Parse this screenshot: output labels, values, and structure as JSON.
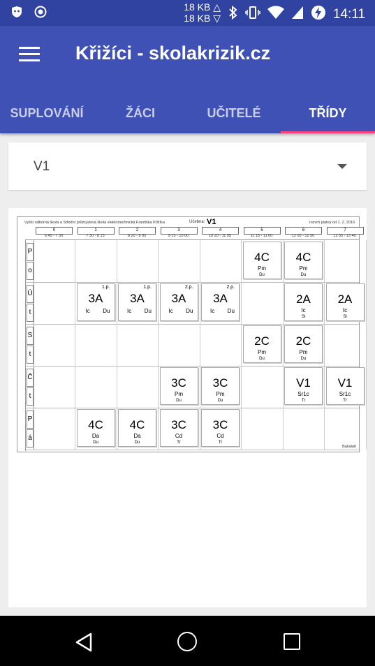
{
  "status_bar": {
    "net_up": "18 KB",
    "net_down": "18 KB",
    "time": "14:11",
    "icons": [
      "shield-icon",
      "circle-record-icon",
      "bluetooth-icon",
      "vibrate-icon",
      "wifi-icon",
      "signal-icon",
      "battery-charging-icon"
    ]
  },
  "app_bar": {
    "title": "Křižíci - skolakrizik.cz",
    "tabs": [
      {
        "label": "SUPLOVÁNÍ",
        "active": false
      },
      {
        "label": "ŽÁCI",
        "active": false
      },
      {
        "label": "UČITELÉ",
        "active": false
      },
      {
        "label": "TŘÍDY",
        "active": true
      }
    ],
    "accent": "#3f51b5",
    "indicator": "#ff4081"
  },
  "selector": {
    "value": "V1"
  },
  "timetable": {
    "school": "Vyšší odborná škola a Střední průmyslová škola elektrotechnická Františka Křižíka",
    "room_label": "Učebna:",
    "room": "V1",
    "valid_from": "rozvrh platný od 1. 2. 2016",
    "periods": [
      {
        "num": "0",
        "time": "6 45 - 7 30"
      },
      {
        "num": "1",
        "time": "7 30 - 8 15"
      },
      {
        "num": "2",
        "time": "8 20 - 9 05"
      },
      {
        "num": "3",
        "time": "9 15 - 10 00"
      },
      {
        "num": "4",
        "time": "10 20 - 11 05"
      },
      {
        "num": "5",
        "time": "11 15 - 11 00"
      },
      {
        "num": "6",
        "time": "12 05 - 12 50"
      },
      {
        "num": "7",
        "time": "12 55 - 13 40"
      }
    ],
    "days": [
      {
        "l1": "P",
        "l2": "o"
      },
      {
        "l1": "Ú",
        "l2": "t"
      },
      {
        "l1": "S",
        "l2": "t"
      },
      {
        "l1": "Č",
        "l2": "t"
      },
      {
        "l1": "P",
        "l2": "á"
      }
    ],
    "lessons": [
      {
        "day": 0,
        "period": 5,
        "cls": "4C",
        "subject": "Pm",
        "teacher": "Du"
      },
      {
        "day": 0,
        "period": 6,
        "cls": "4C",
        "subject": "Pm",
        "teacher": "Du"
      },
      {
        "day": 1,
        "period": 1,
        "cls": "3A",
        "group": "1.p.",
        "subject": "Ic",
        "teacher": "Du",
        "split": true
      },
      {
        "day": 1,
        "period": 2,
        "cls": "3A",
        "group": "1.p.",
        "subject": "Ic",
        "teacher": "Du",
        "split": true
      },
      {
        "day": 1,
        "period": 3,
        "cls": "3A",
        "group": "2.p.",
        "subject": "Ic",
        "teacher": "Du",
        "split": true
      },
      {
        "day": 1,
        "period": 4,
        "cls": "3A",
        "group": "2.p.",
        "subject": "Ic",
        "teacher": "Du",
        "split": true
      },
      {
        "day": 1,
        "period": 6,
        "cls": "2A",
        "subject": "Ic",
        "teacher": "Sl"
      },
      {
        "day": 1,
        "period": 7,
        "cls": "2A",
        "subject": "Ic",
        "teacher": "Sl"
      },
      {
        "day": 2,
        "period": 5,
        "cls": "2C",
        "subject": "Pm",
        "teacher": "Du"
      },
      {
        "day": 2,
        "period": 6,
        "cls": "2C",
        "subject": "Pm",
        "teacher": "Du"
      },
      {
        "day": 3,
        "period": 3,
        "cls": "3C",
        "subject": "Pm",
        "teacher": "Du"
      },
      {
        "day": 3,
        "period": 4,
        "cls": "3C",
        "subject": "Pm",
        "teacher": "Du"
      },
      {
        "day": 3,
        "period": 6,
        "cls": "V1",
        "subject": "Sr1c",
        "teacher": "Tr"
      },
      {
        "day": 3,
        "period": 7,
        "cls": "V1",
        "subject": "Sr1c",
        "teacher": "Tr"
      },
      {
        "day": 4,
        "period": 1,
        "cls": "4C",
        "subject": "Da",
        "teacher": "Du"
      },
      {
        "day": 4,
        "period": 2,
        "cls": "4C",
        "subject": "Da",
        "teacher": "Du"
      },
      {
        "day": 4,
        "period": 3,
        "cls": "3C",
        "subject": "Cd",
        "teacher": "Tr"
      },
      {
        "day": 4,
        "period": 4,
        "cls": "3C",
        "subject": "Cd",
        "teacher": "Tr"
      }
    ],
    "footer": "Bakaláři"
  }
}
